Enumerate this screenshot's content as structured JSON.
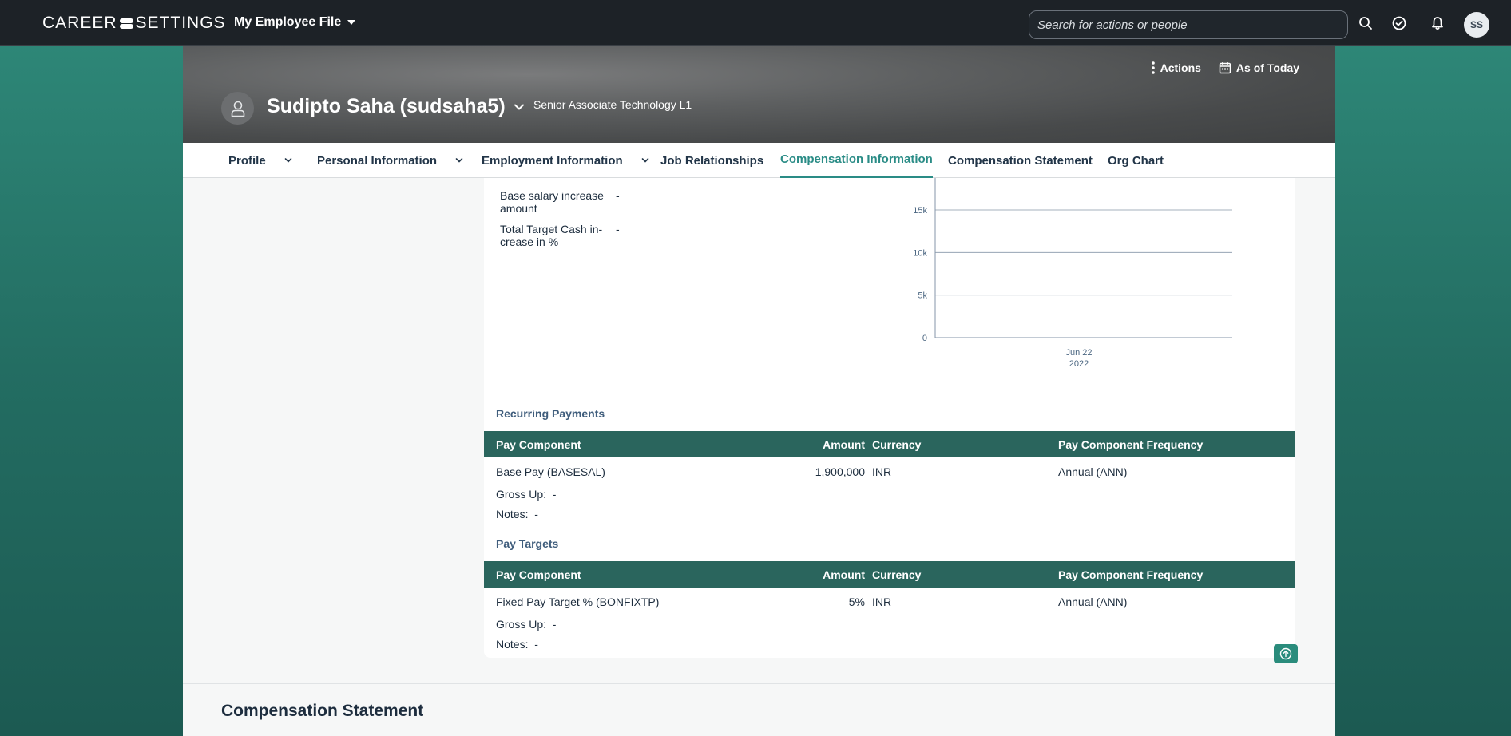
{
  "shell": {
    "logo_left": "CAREER",
    "logo_right": "SETTINGS",
    "app_menu_label": "My Employee File",
    "search_placeholder": "Search for actions or people",
    "avatar_initials": "SS"
  },
  "header": {
    "actions_label": "Actions",
    "as_of_label": "As of Today",
    "person_name": "Sudipto Saha (sudsaha5)",
    "person_title": "Senior Associate Technology L1"
  },
  "tabs": [
    {
      "label": "Profile",
      "has_menu": true
    },
    {
      "label": "Personal Information",
      "has_menu": true
    },
    {
      "label": "Employment Information",
      "has_menu": true
    },
    {
      "label": "Job Relationships",
      "has_menu": false
    },
    {
      "label": "Compensation Information",
      "has_menu": false,
      "active": true
    },
    {
      "label": "Compensation Statement",
      "has_menu": false
    },
    {
      "label": "Org Chart",
      "has_menu": false
    }
  ],
  "summary": {
    "base_increase_label_1": "Base salary increase",
    "base_increase_label_2": "amount",
    "base_increase_value": "-",
    "ttc_label_1": "Total Target Cash in-",
    "ttc_label_2": "crease in %",
    "ttc_value": "-"
  },
  "chart_data": {
    "type": "line",
    "y_ticks": [
      "15k",
      "10k",
      "5k",
      "0"
    ],
    "ylim": [
      0,
      15000
    ],
    "x_ticks": [
      {
        "line1": "Jun 22",
        "line2": "2022"
      }
    ],
    "grid": true,
    "series": []
  },
  "recurring": {
    "title": "Recurring Payments",
    "columns": [
      "Pay Component",
      "Amount",
      "Currency",
      "Pay Component Frequency"
    ],
    "row": {
      "component": "Base Pay (BASESAL)",
      "amount": "1,900,000",
      "currency": "INR",
      "frequency": "Annual (ANN)"
    },
    "gross_up_label": "Gross Up:",
    "gross_up_value": "-",
    "notes_label": "Notes:",
    "notes_value": "-"
  },
  "targets": {
    "title": "Pay Targets",
    "columns": [
      "Pay Component",
      "Amount",
      "Currency",
      "Pay Component Frequency"
    ],
    "row": {
      "component": "Fixed Pay Target % (BONFIXTP)",
      "amount": "5%",
      "currency": "INR",
      "frequency": "Annual (ANN)"
    },
    "gross_up_label": "Gross Up:",
    "gross_up_value": "-",
    "notes_label": "Notes:",
    "notes_value": "-"
  },
  "bottom_section_title": "Compensation Statement",
  "colors": {
    "shell_bg": "#1d2227",
    "accent_teal": "#2a8c86",
    "table_header": "#2a655d",
    "section_title": "#3f5d7c"
  }
}
